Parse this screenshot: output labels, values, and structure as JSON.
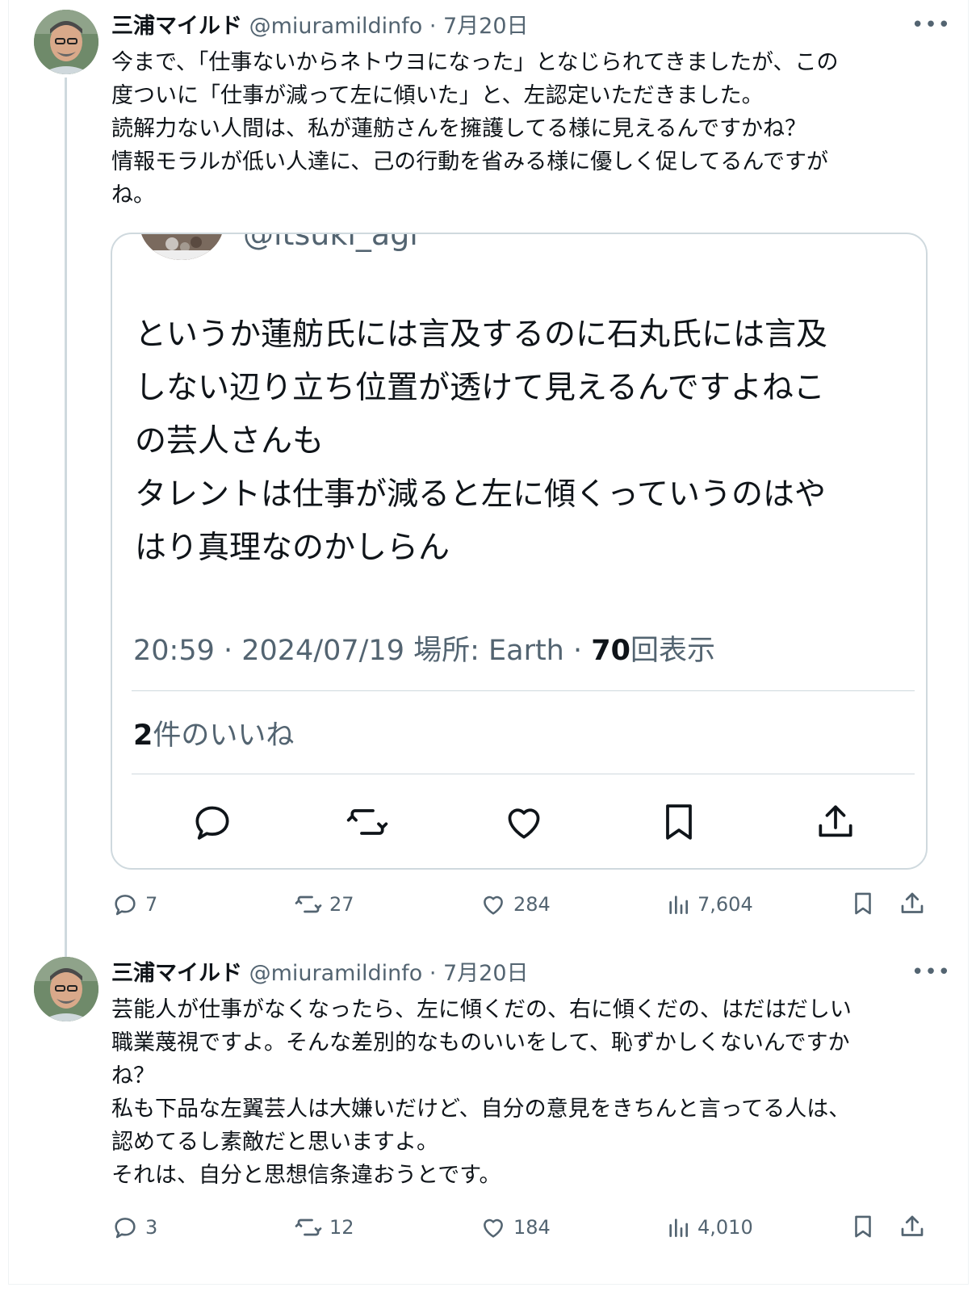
{
  "tweets": [
    {
      "author": "三浦マイルド",
      "handle": "@miuramildinfo",
      "date": "· 7月20日",
      "more": "•••",
      "lines": [
        "今まで、「仕事ないからネトウヨになった」となじられてきましたが、この",
        "度ついに「仕事が減って左に傾いた」と、左認定いただきました。",
        "読解力ない人間は、私が蓮舫さんを擁護してる様に見えるんですかね？",
        "情報モラルが低い人達に、己の行動を省みる様に優しく促してるんですが",
        "ね。"
      ],
      "replies": "7",
      "reposts": "27",
      "likes": "284",
      "views": "7,604"
    },
    {
      "author": "三浦マイルド",
      "handle": "@miuramildinfo",
      "date": "· 7月20日",
      "more": "•••",
      "lines": [
        "芸能人が仕事がなくなったら、左に傾くだの、右に傾くだの、はだはだしい",
        "職業蔑視ですよ。そんな差別的なものいいをして、恥ずかしくないんですか",
        "ね？",
        "私も下品な左翼芸人は大嫌いだけど、自分の意見をきちんと言ってる人は、",
        "認めてるし素敵だと思いますよ。",
        "それは、自分と思想信条違おうとです。"
      ],
      "replies": "3",
      "reposts": "12",
      "likes": "184",
      "views": "4,010"
    }
  ],
  "quote": {
    "handle": "@itsuki_agi",
    "lines": [
      "というか蓮舫氏には言及するのに石丸氏には言及",
      "しない辺り立ち位置が透けて見えるんですよねこ",
      "の芸人さんも",
      "タレントは仕事が減ると左に傾くっていうのはや",
      "はり真理なのかしらん"
    ],
    "time": "20:59 · 2024/07/19 場所: Earth · ",
    "views_count": "70",
    "views_label": "回表示",
    "likes_count": "2",
    "likes_label": "件のいいね"
  },
  "icons": {
    "reply": "reply-icon",
    "repost": "repost-icon",
    "like": "heart-icon",
    "views": "views-icon",
    "bookmark": "bookmark-icon",
    "share": "share-icon"
  },
  "colors": {
    "text": "#0f1419",
    "muted": "#536471",
    "border": "#cfd9de"
  }
}
